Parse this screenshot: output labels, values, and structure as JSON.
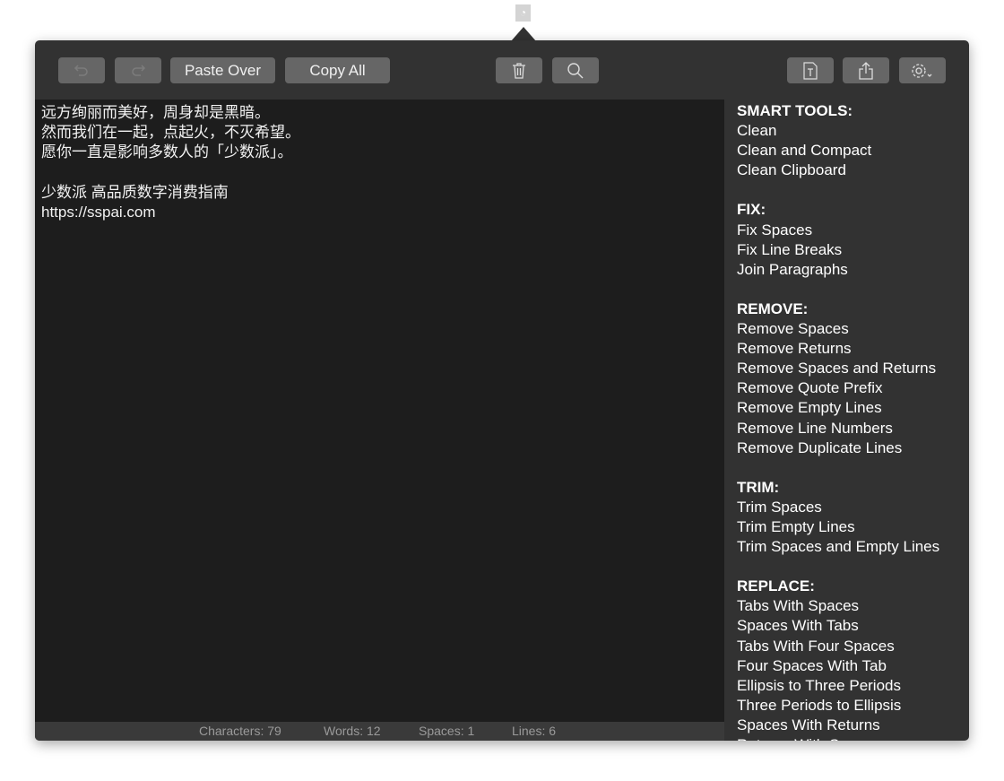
{
  "toolbar": {
    "undo": "undo-icon",
    "redo": "redo-icon",
    "paste_over": "Paste Over",
    "copy_all": "Copy All",
    "trash": "trash-icon",
    "search": "search-icon",
    "text_file": "text-file-icon",
    "share": "share-icon",
    "settings": "gear-icon"
  },
  "editor": {
    "lines": [
      "远方绚丽而美好，周身却是黑暗。",
      "然而我们在一起，点起火，不灭希望。",
      "愿你一直是影响多数人的「少数派」。",
      "",
      "少数派 高品质数字消费指南",
      "https://sspai.com"
    ]
  },
  "status": {
    "characters": "Characters: 79",
    "words": "Words: 12",
    "spaces": "Spaces: 1",
    "lines": "Lines: 6"
  },
  "sidebar": {
    "sections": [
      {
        "title": "SMART TOOLS:",
        "items": [
          "Clean",
          "Clean and Compact",
          "Clean Clipboard"
        ]
      },
      {
        "title": "FIX:",
        "items": [
          "Fix Spaces",
          "Fix Line Breaks",
          "Join Paragraphs"
        ]
      },
      {
        "title": "REMOVE:",
        "items": [
          "Remove Spaces",
          "Remove Returns",
          "Remove Spaces and Returns",
          "Remove Quote Prefix",
          "Remove Empty Lines",
          "Remove Line Numbers",
          "Remove Duplicate Lines"
        ]
      },
      {
        "title": "TRIM:",
        "items": [
          "Trim Spaces",
          "Trim Empty Lines",
          "Trim Spaces and Empty Lines"
        ]
      },
      {
        "title": "REPLACE:",
        "items": [
          "Tabs With Spaces",
          "Spaces With Tabs",
          "Tabs With Four Spaces",
          "Four Spaces With Tab",
          "Ellipsis to Three Periods",
          "Three Periods to Ellipsis",
          "Spaces With Returns",
          "Returns With Spaces"
        ]
      }
    ]
  }
}
